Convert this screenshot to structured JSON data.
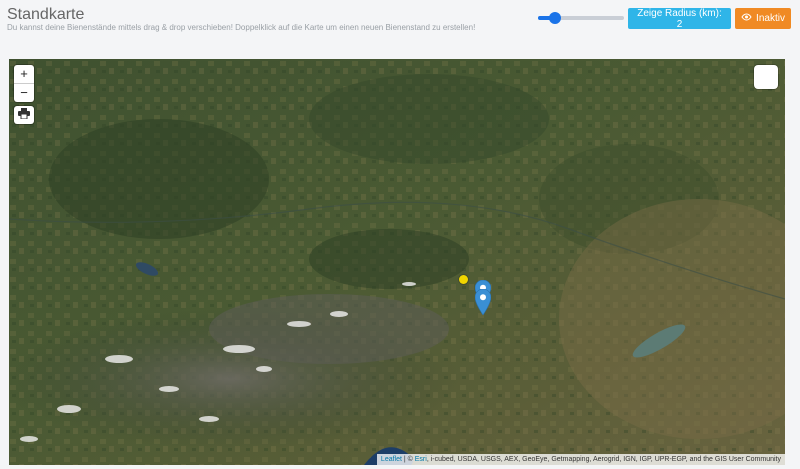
{
  "header": {
    "title": "Standkarte",
    "subtitle": "Du kannst deine Bienenstände mittels drag & drop verschieben! Doppelklick auf die Karte um einen neuen Bienenstand zu erstellen!"
  },
  "controls": {
    "radius_slider_value": 0.2,
    "radius_button_label": "Zeige Radius (km): 2",
    "inactive_button_label": "Inaktiv",
    "inactive_button_icon": "eye-icon"
  },
  "map": {
    "zoom_in_label": "+",
    "zoom_out_label": "−",
    "print_icon": "print-icon",
    "attribution": {
      "leaflet": "Leaflet",
      "separator": " | © ",
      "esri": "Esri",
      "rest": ", i-cubed, USDA, USGS, AEX, GeoEye, Getmapping, Aerogrid, IGN, IGP, UPR-EGP, and the GIS User Community"
    }
  },
  "colors": {
    "radius_button": "#2fb5e8",
    "inactive_button": "#f08a24",
    "marker": "#3a8fd4",
    "yellow_marker": "#f1d600",
    "slider": "#1a73e8"
  }
}
